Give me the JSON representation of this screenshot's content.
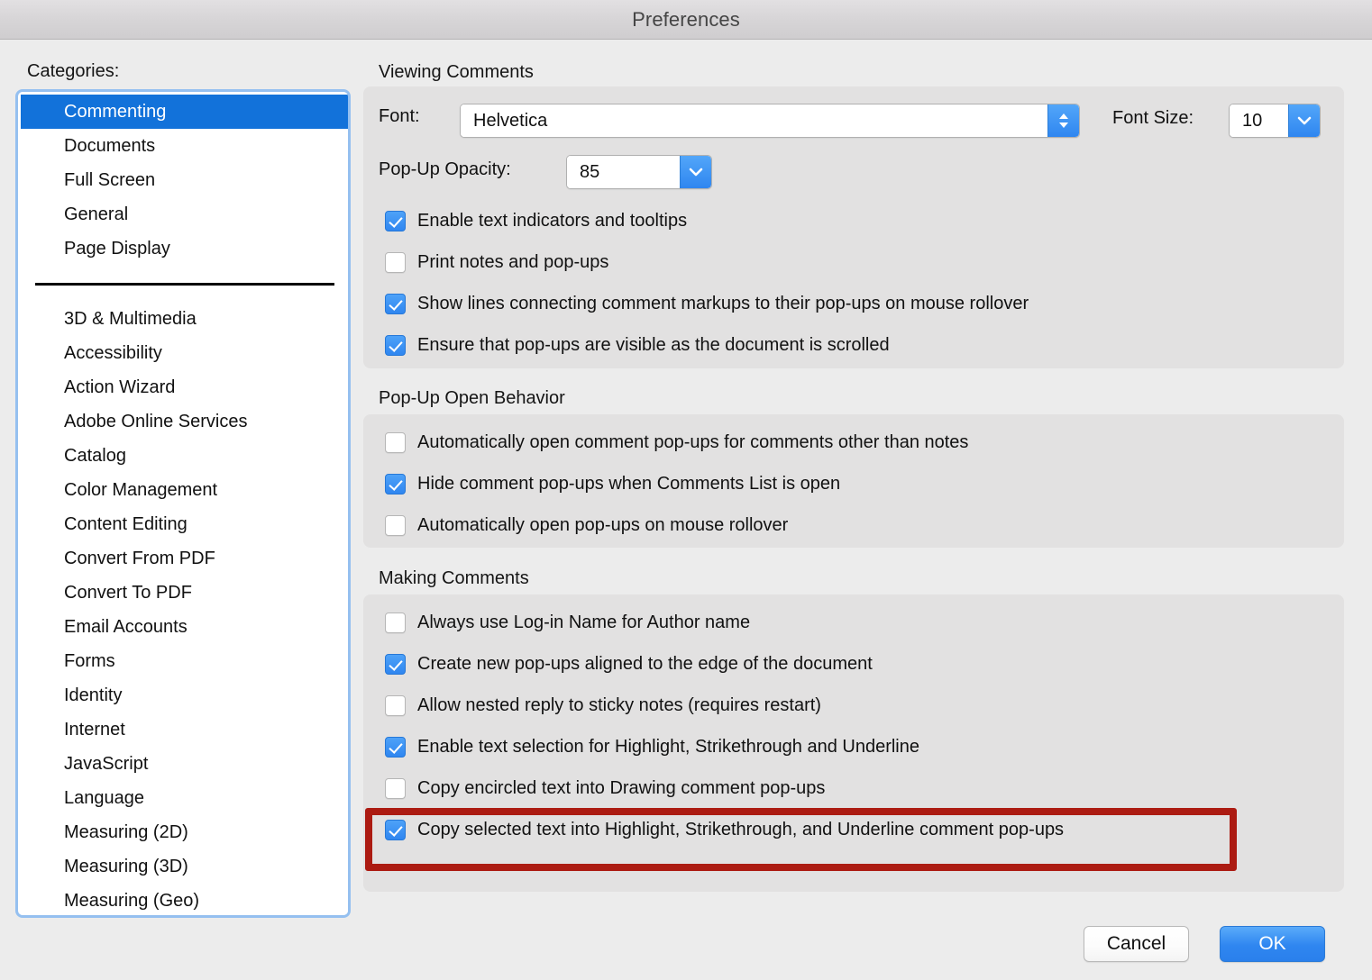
{
  "window": {
    "title": "Preferences"
  },
  "sidebar": {
    "label": "Categories:",
    "items": [
      {
        "label": "Commenting",
        "selected": true
      },
      {
        "label": "Documents",
        "selected": false
      },
      {
        "label": "Full Screen",
        "selected": false
      },
      {
        "label": "General",
        "selected": false
      },
      {
        "label": "Page Display",
        "selected": false
      },
      {
        "separator": true
      },
      {
        "label": "3D & Multimedia",
        "selected": false
      },
      {
        "label": "Accessibility",
        "selected": false
      },
      {
        "label": "Action Wizard",
        "selected": false
      },
      {
        "label": "Adobe Online Services",
        "selected": false
      },
      {
        "label": "Catalog",
        "selected": false
      },
      {
        "label": "Color Management",
        "selected": false
      },
      {
        "label": "Content Editing",
        "selected": false
      },
      {
        "label": "Convert From PDF",
        "selected": false
      },
      {
        "label": "Convert To PDF",
        "selected": false
      },
      {
        "label": "Email Accounts",
        "selected": false
      },
      {
        "label": "Forms",
        "selected": false
      },
      {
        "label": "Identity",
        "selected": false
      },
      {
        "label": "Internet",
        "selected": false
      },
      {
        "label": "JavaScript",
        "selected": false
      },
      {
        "label": "Language",
        "selected": false
      },
      {
        "label": "Measuring (2D)",
        "selected": false
      },
      {
        "label": "Measuring (3D)",
        "selected": false
      },
      {
        "label": "Measuring (Geo)",
        "selected": false
      }
    ]
  },
  "viewing_comments": {
    "title": "Viewing Comments",
    "font_label": "Font:",
    "font_value": "Helvetica",
    "font_size_label": "Font Size:",
    "font_size_value": "10",
    "opacity_label": "Pop-Up Opacity:",
    "opacity_value": "85",
    "checkboxes": [
      {
        "label": "Enable text indicators and tooltips",
        "checked": true
      },
      {
        "label": "Print notes and pop-ups",
        "checked": false
      },
      {
        "label": "Show lines connecting comment markups to their pop-ups on mouse rollover",
        "checked": true
      },
      {
        "label": "Ensure that pop-ups are visible as the document is scrolled",
        "checked": true
      }
    ]
  },
  "popup_open_behavior": {
    "title": "Pop-Up Open Behavior",
    "checkboxes": [
      {
        "label": "Automatically open comment pop-ups for comments other than notes",
        "checked": false
      },
      {
        "label": "Hide comment pop-ups when Comments List is open",
        "checked": true
      },
      {
        "label": "Automatically open pop-ups on mouse rollover",
        "checked": false
      }
    ]
  },
  "making_comments": {
    "title": "Making Comments",
    "checkboxes": [
      {
        "label": "Always use Log-in Name for Author name",
        "checked": false
      },
      {
        "label": "Create new pop-ups aligned to the edge of the document",
        "checked": true
      },
      {
        "label": "Allow nested reply to sticky notes (requires restart)",
        "checked": false
      },
      {
        "label": "Enable text selection for Highlight, Strikethrough and Underline",
        "checked": true
      },
      {
        "label": "Copy encircled text into Drawing comment pop-ups",
        "checked": false
      },
      {
        "label": "Copy selected text into Highlight, Strikethrough, and Underline comment pop-ups",
        "checked": true,
        "highlighted": true
      }
    ]
  },
  "footer": {
    "cancel_label": "Cancel",
    "ok_label": "OK"
  },
  "colors": {
    "accent_blue": "#1272da",
    "checkbox_blue": "#2f86f0",
    "annotation_red": "#ac1b12",
    "dialog_bg": "#ececec",
    "group_bg": "#e2e1e1"
  }
}
